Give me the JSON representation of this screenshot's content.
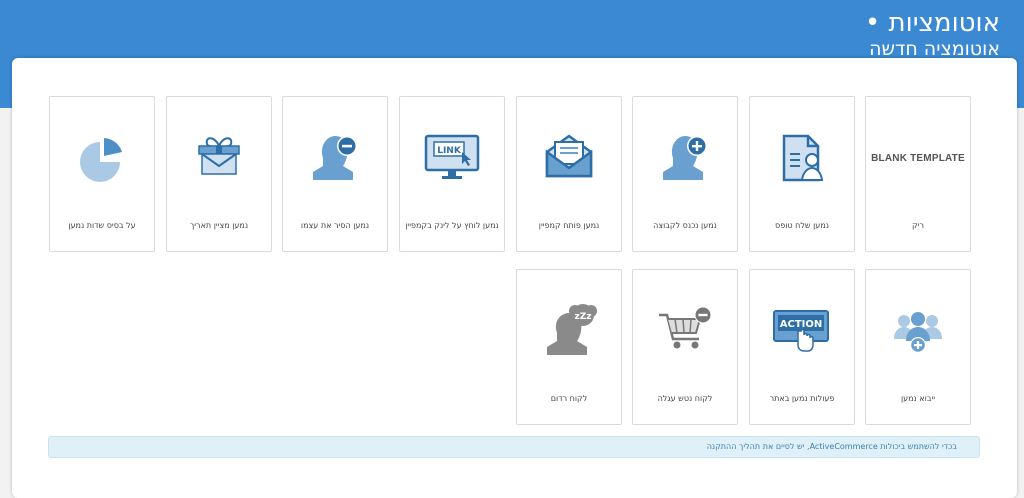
{
  "header": {
    "title": "אוטומציות •",
    "subtitle": "אוטומציה חדשה"
  },
  "templates": {
    "row1": [
      {
        "label": "ריק",
        "icon": "blank-template-text",
        "icon_text": "BLANK TEMPLATE"
      },
      {
        "label": "נמען שלח טופס",
        "icon": "form-user-icon"
      },
      {
        "label": "נמען נכנס לקבוצה",
        "icon": "user-add-icon"
      },
      {
        "label": "נמען פותח קמפיין",
        "icon": "open-envelope-icon"
      },
      {
        "label": "נמען לוחץ על לינק בקמפיין",
        "icon": "link-monitor-icon",
        "icon_text": "LINK"
      },
      {
        "label": "נמען הסיר את עצמו",
        "icon": "user-remove-icon"
      },
      {
        "label": "נמען מציין תאריך",
        "icon": "gift-icon"
      },
      {
        "label": "על בסיס שדות נמען",
        "icon": "pie-chart-icon"
      }
    ],
    "row2": [
      {
        "label": "ייבוא נמען",
        "icon": "users-add-icon"
      },
      {
        "label": "פעולות נמען באתר",
        "icon": "action-button-icon",
        "icon_text": "ACTION"
      },
      {
        "label": "לקוח נטש עגלה",
        "icon": "cart-remove-icon"
      },
      {
        "label": "לקוח רדום",
        "icon": "sleeping-user-icon",
        "icon_text": "zZz"
      }
    ]
  },
  "notice": {
    "text": "בכדי להשתמש ביכולות ActiveCommerce, יש לסיים את תהליך ההתקנה"
  },
  "colors": {
    "header": "#3a89d2",
    "icon_blue": "#6aa0cf",
    "icon_dark": "#2e6ea6",
    "icon_grey": "#8a8a8a"
  }
}
